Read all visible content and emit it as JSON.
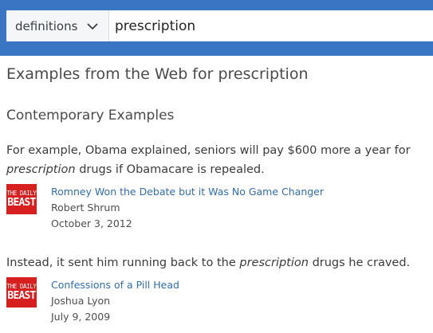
{
  "search": {
    "category": "definitions",
    "query": "prescription"
  },
  "page": {
    "title": "Examples from the Web for prescription",
    "section_title": "Contemporary Examples"
  },
  "examples": [
    {
      "sentence_before": "For example, Obama explained, seniors will pay $600 more a year for ",
      "highlight": "prescription",
      "sentence_after": " drugs if Obamacare is repealed.",
      "source": {
        "logo_line1": "THE DAILY",
        "logo_line2": "BEAST",
        "title": "Romney Won the Debate but it Was No Game Changer",
        "author": "Robert Shrum",
        "date": "October 3, 2012"
      }
    },
    {
      "sentence_before": "Instead, it sent him running back to the ",
      "highlight": "prescription",
      "sentence_after": " drugs he craved.",
      "source": {
        "logo_line1": "THE DAILY",
        "logo_line2": "BEAST",
        "title": "Confessions of a Pill Head",
        "author": "Joshua Lyon",
        "date": "July 9, 2009"
      }
    }
  ],
  "colors": {
    "header_blue": "#3a75c4",
    "logo_red": "#d81f1f",
    "link_blue": "#2f6db5"
  }
}
